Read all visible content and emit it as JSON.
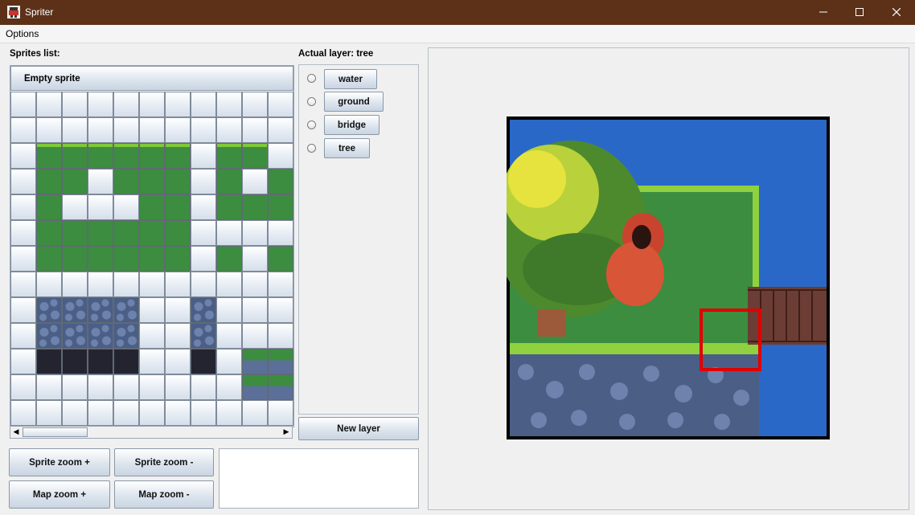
{
  "window": {
    "title": "Spriter",
    "minimize_glyph": "—",
    "maximize_glyph": "☐",
    "close_glyph": "✕"
  },
  "menu": {
    "items": [
      "Options"
    ]
  },
  "sprites": {
    "label": "Sprites list:",
    "empty_sprite_label": "Empty sprite",
    "grid_columns": 11,
    "grid_rows": 13,
    "tile_legend": {
      ".": "empty",
      "g": "grass",
      "e": "grass-edge",
      "s": "stone",
      "d": "dark",
      "b": "bridge"
    },
    "grid": [
      "...........",
      "...........",
      ".eeeeee.ee.",
      ".gg.ggg.g.g",
      ".g...gg.gggg",
      ".gggggg....",
      ".gggggg.g.g",
      "...........",
      ".ssss..s...",
      ".ssss..s...",
      ".dddd..d.bb",
      ".........bb",
      "..........."
    ]
  },
  "layers": {
    "label": "Actual layer: tree",
    "items": [
      {
        "label": "water"
      },
      {
        "label": "ground"
      },
      {
        "label": "bridge"
      },
      {
        "label": "tree"
      }
    ],
    "new_layer_label": "New layer"
  },
  "controls": {
    "sprite_zoom_in": "Sprite zoom +",
    "sprite_zoom_out": "Sprite zoom -",
    "map_zoom_in": "Map zoom +",
    "map_zoom_out": "Map zoom -"
  },
  "colors": {
    "titlebar": "#5c3118",
    "water": "#2a68c8",
    "grass": "#3c8d3f",
    "grass_light": "#8fd13f",
    "stone": "#4b5e86",
    "bridge": "#6b3d34",
    "tree_light": "#e6e33e",
    "selection": "#e00000"
  }
}
